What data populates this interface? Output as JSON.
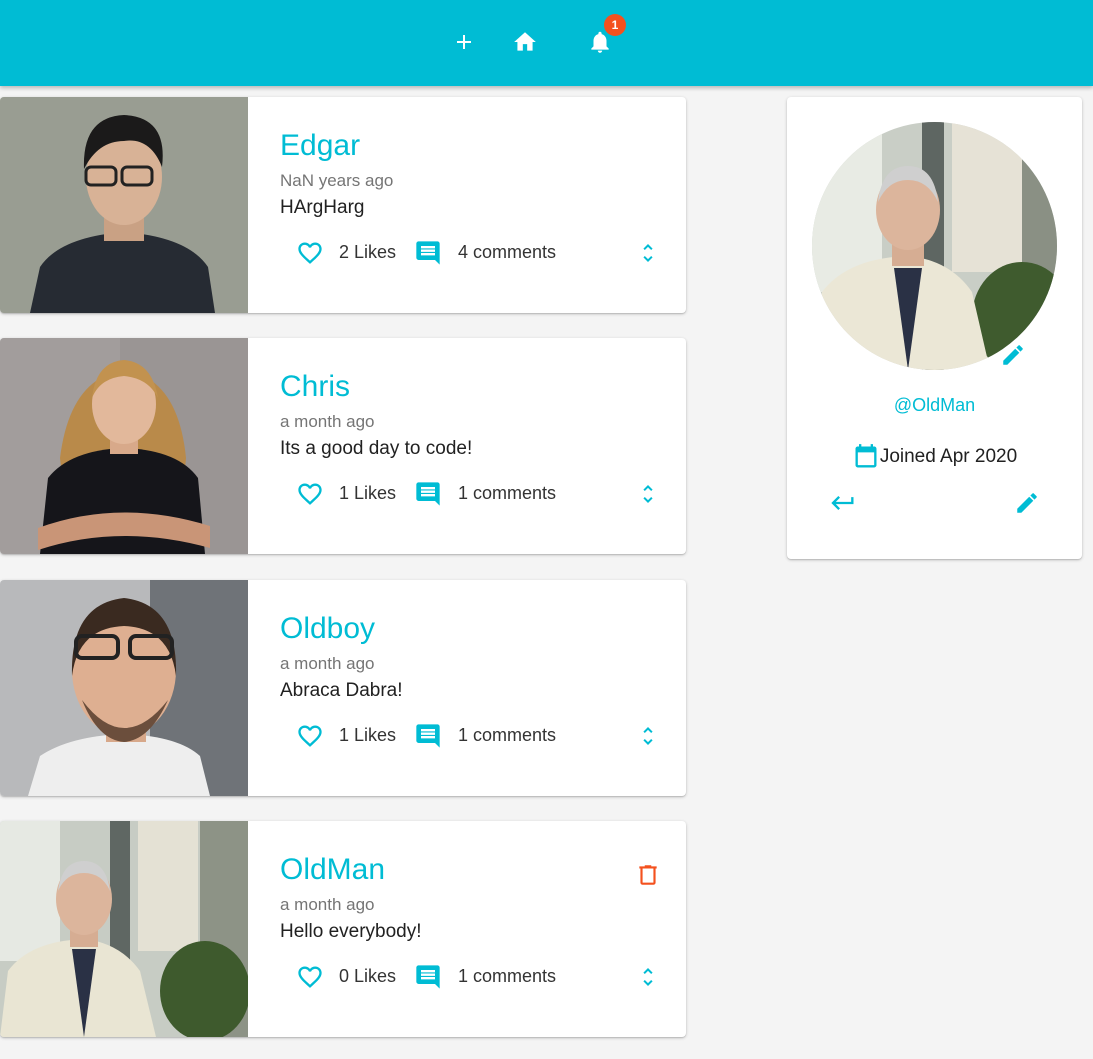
{
  "colors": {
    "primary": "#00bcd4",
    "danger": "#f4511e",
    "background": "#f4f4f4"
  },
  "navbar": {
    "items": [
      {
        "icon": "add-icon"
      },
      {
        "icon": "home-icon"
      },
      {
        "icon": "notifications-icon",
        "badge": "1"
      }
    ]
  },
  "posts": [
    {
      "user": "Edgar",
      "time": "NaN years ago",
      "body": "HArgHarg",
      "likes": "2 Likes",
      "comments": "4 comments",
      "deletable": false
    },
    {
      "user": "Chris",
      "time": "a month ago",
      "body": "Its a good day to code!",
      "likes": "1 Likes",
      "comments": "1 comments",
      "deletable": false
    },
    {
      "user": "Oldboy",
      "time": "a month ago",
      "body": "Abraca Dabra!",
      "likes": "1 Likes",
      "comments": "1 comments",
      "deletable": false
    },
    {
      "user": "OldMan",
      "time": "a month ago",
      "body": "Hello everybody!",
      "likes": "0 Likes",
      "comments": "1 comments",
      "deletable": true
    }
  ],
  "profile": {
    "handle": "@OldMan",
    "joined": "Joined Apr 2020"
  }
}
